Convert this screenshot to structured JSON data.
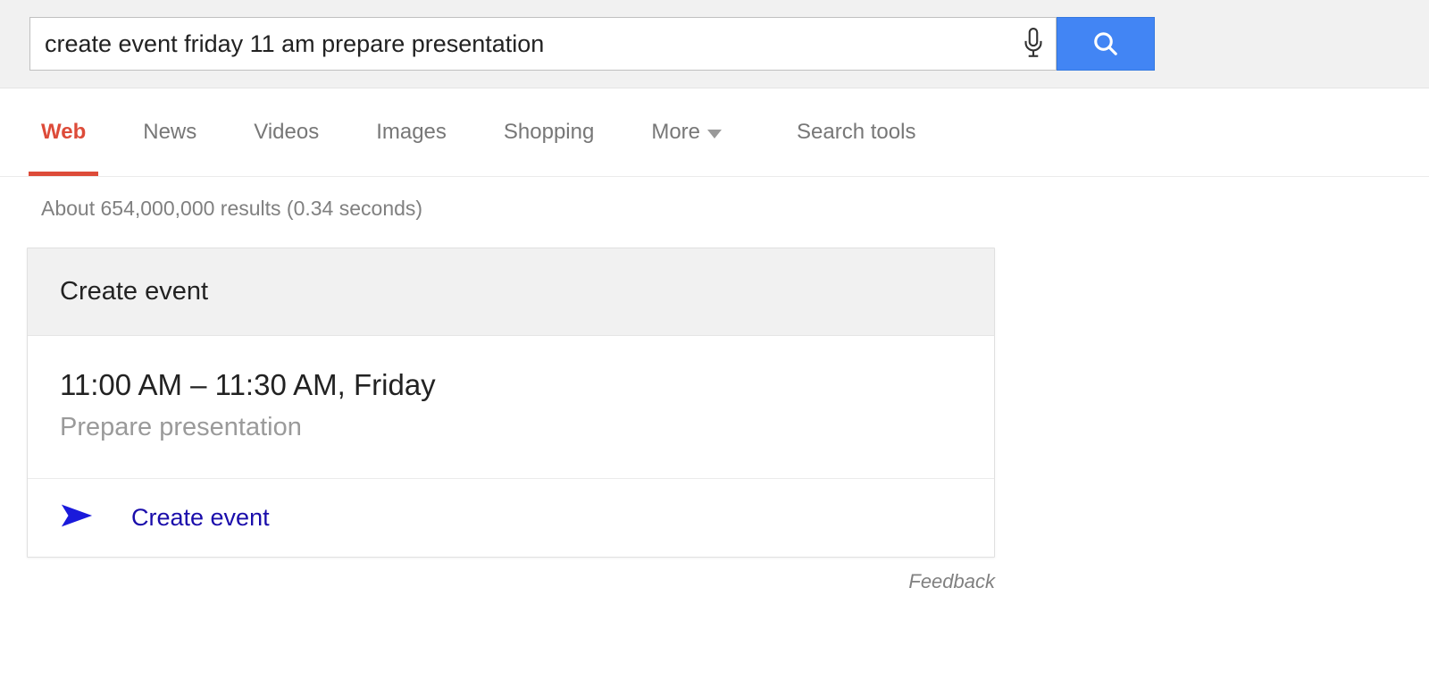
{
  "search": {
    "query": "create event friday 11 am prepare presentation"
  },
  "tabs": {
    "web": "Web",
    "news": "News",
    "videos": "Videos",
    "images": "Images",
    "shopping": "Shopping",
    "more": "More",
    "search_tools": "Search tools"
  },
  "stats": "About 654,000,000 results (0.34 seconds)",
  "card": {
    "title": "Create event",
    "time": "11:00 AM – 11:30 AM, Friday",
    "description": "Prepare presentation",
    "action": "Create event"
  },
  "feedback": "Feedback"
}
